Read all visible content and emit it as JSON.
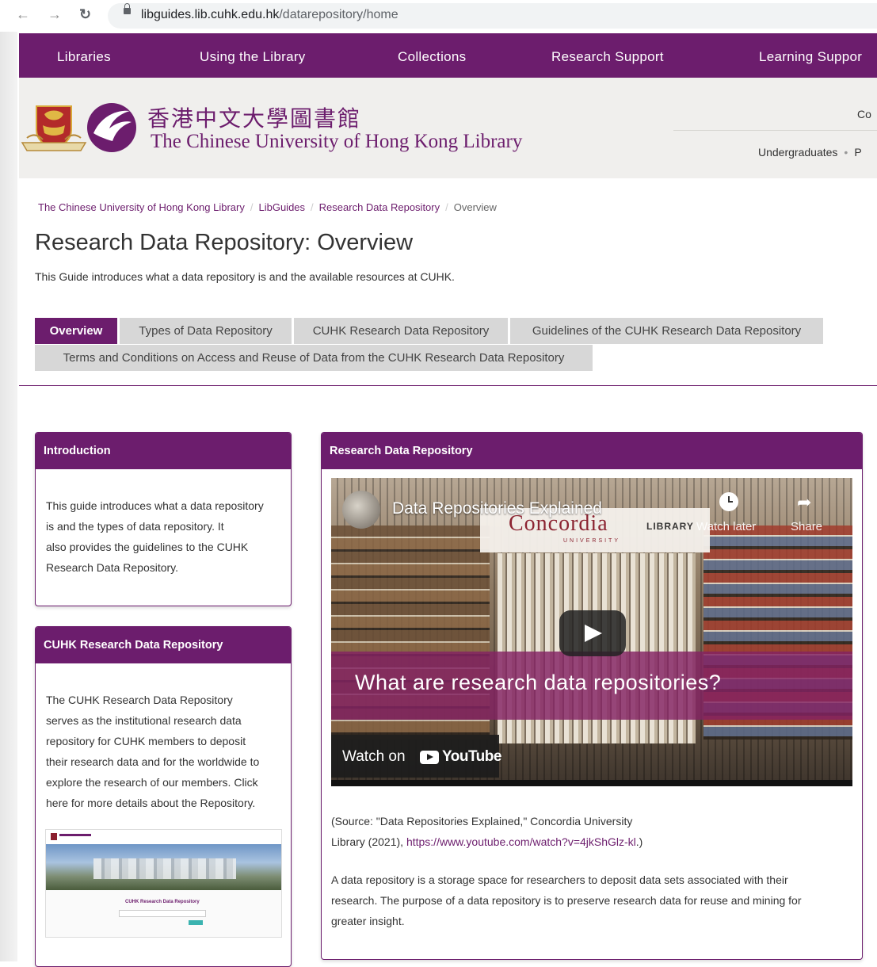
{
  "browser": {
    "url_host": "libguides.lib.cuhk.edu.hk",
    "url_path": "/datarepository/home"
  },
  "topnav": {
    "items": [
      "Libraries",
      "Using the Library",
      "Collections",
      "Research Support",
      "Learning Suppor"
    ]
  },
  "header": {
    "chinese_name": "香港中文大學圖書館",
    "english_name": "The Chinese University of Hong Kong Library",
    "right_top": "Co",
    "right_bottom_link": "Undergraduates",
    "right_bottom_sep": "•",
    "right_bottom_next": "P"
  },
  "breadcrumb": {
    "items": [
      "The Chinese University of Hong Kong Library",
      "LibGuides",
      "Research Data Repository"
    ],
    "sep": "/",
    "current": "Overview"
  },
  "page": {
    "title": "Research Data Repository: Overview",
    "description": "This Guide introduces what a data repository is and the available resources at CUHK."
  },
  "tabs": [
    "Overview",
    "Types of Data Repository",
    "CUHK Research Data Repository",
    "Guidelines of the CUHK Research Data Repository",
    "Terms and Conditions on Access and Reuse of Data from the CUHK Research Data Repository"
  ],
  "intro_box": {
    "title": "Introduction",
    "lines": [
      "This guide introduces what a data repository",
      "is and the types of data repository. It",
      "also provides the guidelines to the CUHK",
      "Research Data Repository."
    ]
  },
  "cuhk_box": {
    "title": "CUHK Research Data Repository",
    "lines": [
      "The CUHK Research Data Repository",
      "serves as the institutional research data",
      "repository for CUHK members to deposit",
      "their research data and for the worldwide to",
      "explore the research of our members.  Click",
      "here for more details about the Repository."
    ]
  },
  "rdr_box": {
    "title": "Research Data Repository"
  },
  "video": {
    "title": "Data Repositories Explained",
    "sign_brand": "Concordia",
    "sign_university": "UNIVERSITY",
    "sign_library": "LIBRARY",
    "watch_later": "Watch later",
    "share": "Share",
    "banner": "What are research data repositories?",
    "watch_on": "Watch on",
    "youtube": "YouTube"
  },
  "source": {
    "line1": "(Source: \"Data Repositories Explained,\" Concordia University",
    "line2_prefix": "Library (2021), ",
    "link": "https://www.youtube.com/watch?v=4jkShGlz-kl",
    "line2_suffix": ".)"
  },
  "description": {
    "lines": [
      "A data repository is a storage space for researchers to deposit data sets associated with their",
      "research. The purpose of a data repository is to preserve research data for reuse and mining for",
      "greater insight."
    ]
  },
  "thumbnail": {
    "caption": "CUHK Research Data Repository"
  },
  "colors": {
    "brand_purple": "#6c1d6d",
    "tab_gray": "#d7d7d7",
    "header_bg": "#f0efed"
  }
}
